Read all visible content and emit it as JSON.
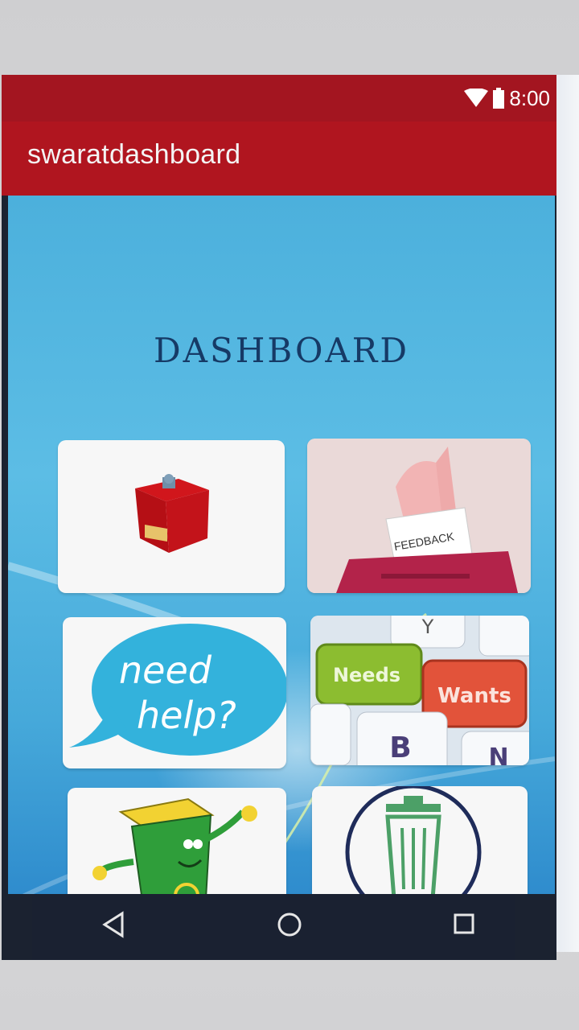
{
  "status_bar": {
    "time": "8:00",
    "icons": [
      "wifi-icon",
      "battery-icon"
    ]
  },
  "app_bar": {
    "title": "swaratdashboard",
    "color": "#b0151f"
  },
  "dashboard": {
    "title": "DASHBOARD",
    "tiles": [
      {
        "name": "complaint-box-tile",
        "image": "complaint-box"
      },
      {
        "name": "feedback-tile",
        "image": "feedback-ballot",
        "caption": "FEEDBACK"
      },
      {
        "name": "need-help-tile",
        "image": "speech-bubble",
        "caption_line1": "need",
        "caption_line2": "help?"
      },
      {
        "name": "needs-wants-tile",
        "image": "keyboard-keys",
        "key1": "Needs",
        "key2": "Wants",
        "key3": "B",
        "key4": "N",
        "key5": "Y"
      },
      {
        "name": "waste-bin-tile",
        "image": "cartoon-green-bin"
      },
      {
        "name": "search-bin-tile",
        "image": "magnifier-trash-can"
      }
    ]
  },
  "nav_bar": {
    "buttons": [
      "back-icon",
      "home-icon",
      "recents-icon"
    ]
  }
}
